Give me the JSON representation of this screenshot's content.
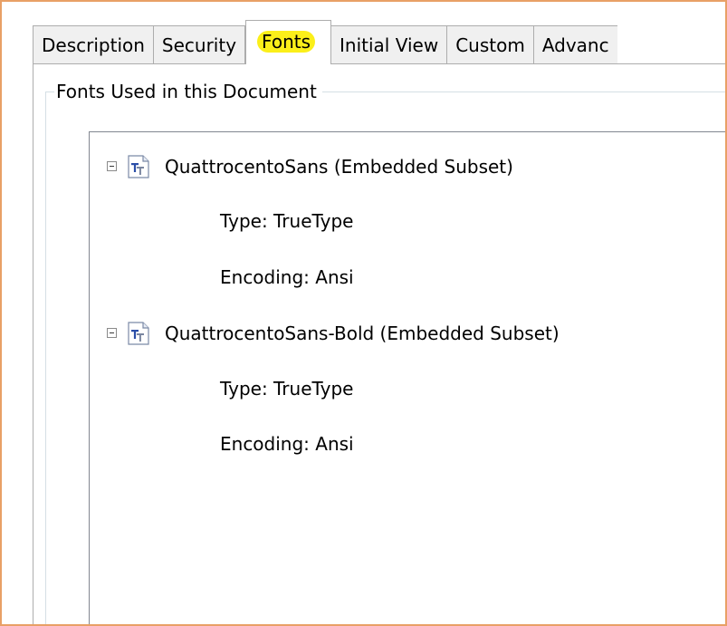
{
  "tabs": [
    {
      "label": "Description",
      "active": false
    },
    {
      "label": "Security",
      "active": false
    },
    {
      "label": "Fonts",
      "active": true
    },
    {
      "label": "Initial View",
      "active": false
    },
    {
      "label": "Custom",
      "active": false
    },
    {
      "label": "Advanc",
      "active": false
    }
  ],
  "group": {
    "title": "Fonts Used in this Document"
  },
  "fonts": [
    {
      "name": "QuattrocentoSans (Embedded Subset)",
      "type": "Type: TrueType",
      "encoding": "Encoding: Ansi",
      "expanded": true,
      "icon": "truetype-font-icon"
    },
    {
      "name": "QuattrocentoSans-Bold (Embedded Subset)",
      "type": "Type: TrueType",
      "encoding": "Encoding: Ansi",
      "expanded": true,
      "icon": "truetype-font-icon"
    }
  ],
  "colors": {
    "highlight": "#fbef1a",
    "frame_border": "#e8a066",
    "icon_blue": "#2b4ea8"
  }
}
